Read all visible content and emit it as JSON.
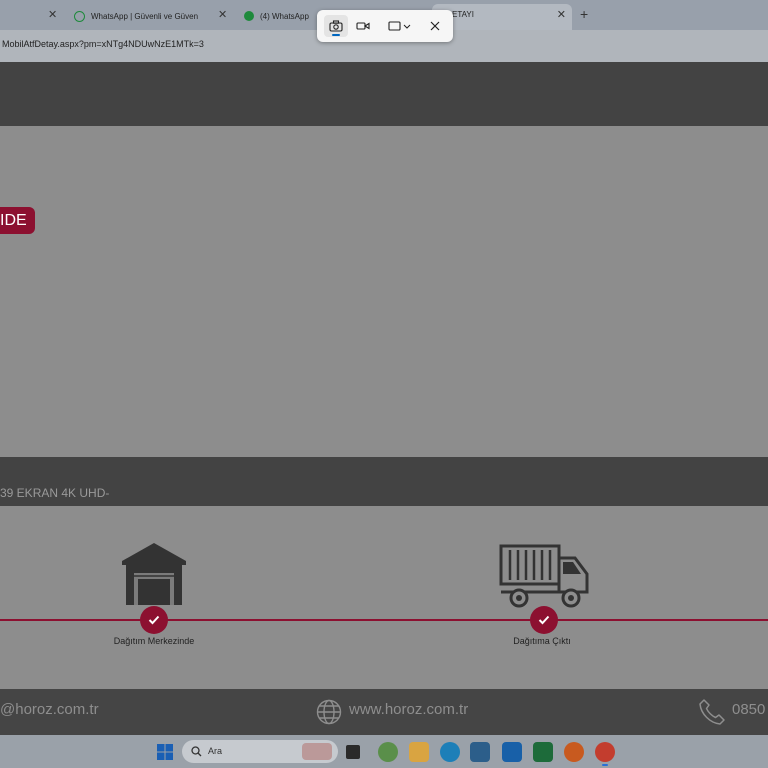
{
  "browser": {
    "tabs": [
      {
        "label": "",
        "kind": "blank"
      },
      {
        "label": "WhatsApp | Güvenli ve Güven",
        "kind": "whatsapp"
      },
      {
        "label": "(4) WhatsApp",
        "kind": "whatsapp-badge"
      }
    ],
    "active_tab": {
      "label": "ETAYI"
    },
    "url": "MobilAtfDetay.aspx?pm=xNTg4NDUwNzE1MTk=3"
  },
  "snipping_tool": {
    "tools": [
      "camera-icon",
      "video-icon",
      "rectangle-mode-icon",
      "close-icon"
    ]
  },
  "shipment": {
    "status_label": "IDE",
    "product_name": "39 EKRAN 4K UHD-"
  },
  "timeline": {
    "steps": [
      {
        "label": "Dağıtım Merkezinde",
        "icon": "warehouse-icon"
      },
      {
        "label": "Dağıtıma Çıktı",
        "icon": "truck-icon"
      }
    ]
  },
  "footer": {
    "email": "@horoz.com.tr",
    "website": "www.horoz.com.tr",
    "phone": "0850"
  },
  "taskbar": {
    "search_placeholder": "Ara"
  },
  "colors": {
    "accent": "#8c1030",
    "dark_band": "#434343",
    "overlay_gray": "#8d8d8d"
  }
}
